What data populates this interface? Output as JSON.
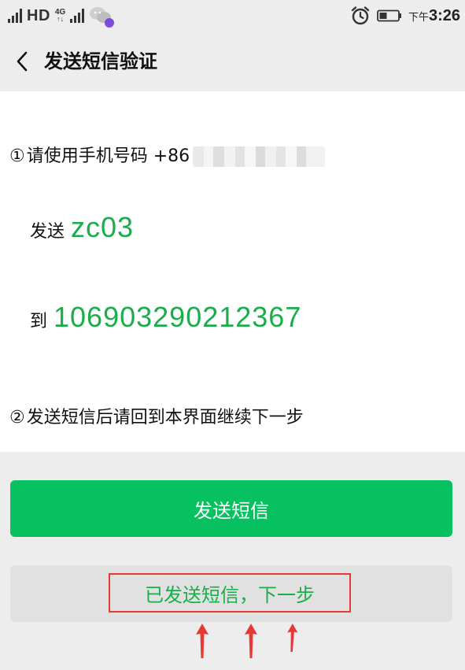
{
  "status_bar": {
    "network_label": "HD",
    "network_type": "4G",
    "ampm": "下午",
    "time": "3:26",
    "icons": [
      "signal-icon",
      "signal-icon",
      "wechat-icon",
      "alarm-icon",
      "battery-icon"
    ]
  },
  "header": {
    "title": "发送短信验证",
    "back_icon": "back-arrow-icon"
  },
  "instructions": {
    "step1_num": "①",
    "step1_text": "请使用手机号码 +86",
    "send_label": "发送",
    "send_code": "zc03",
    "to_label": "到",
    "to_number": "106903290212367",
    "step2_num": "②",
    "step2_text": "发送短信后请回到本界面继续下一步"
  },
  "buttons": {
    "send_sms_label": "发送短信",
    "next_step_label": "已发送短信，下一步"
  },
  "colors": {
    "primary_green": "#07c160",
    "text_green": "#1aad4a",
    "annotation_red": "#e53935",
    "background": "#ededed"
  }
}
